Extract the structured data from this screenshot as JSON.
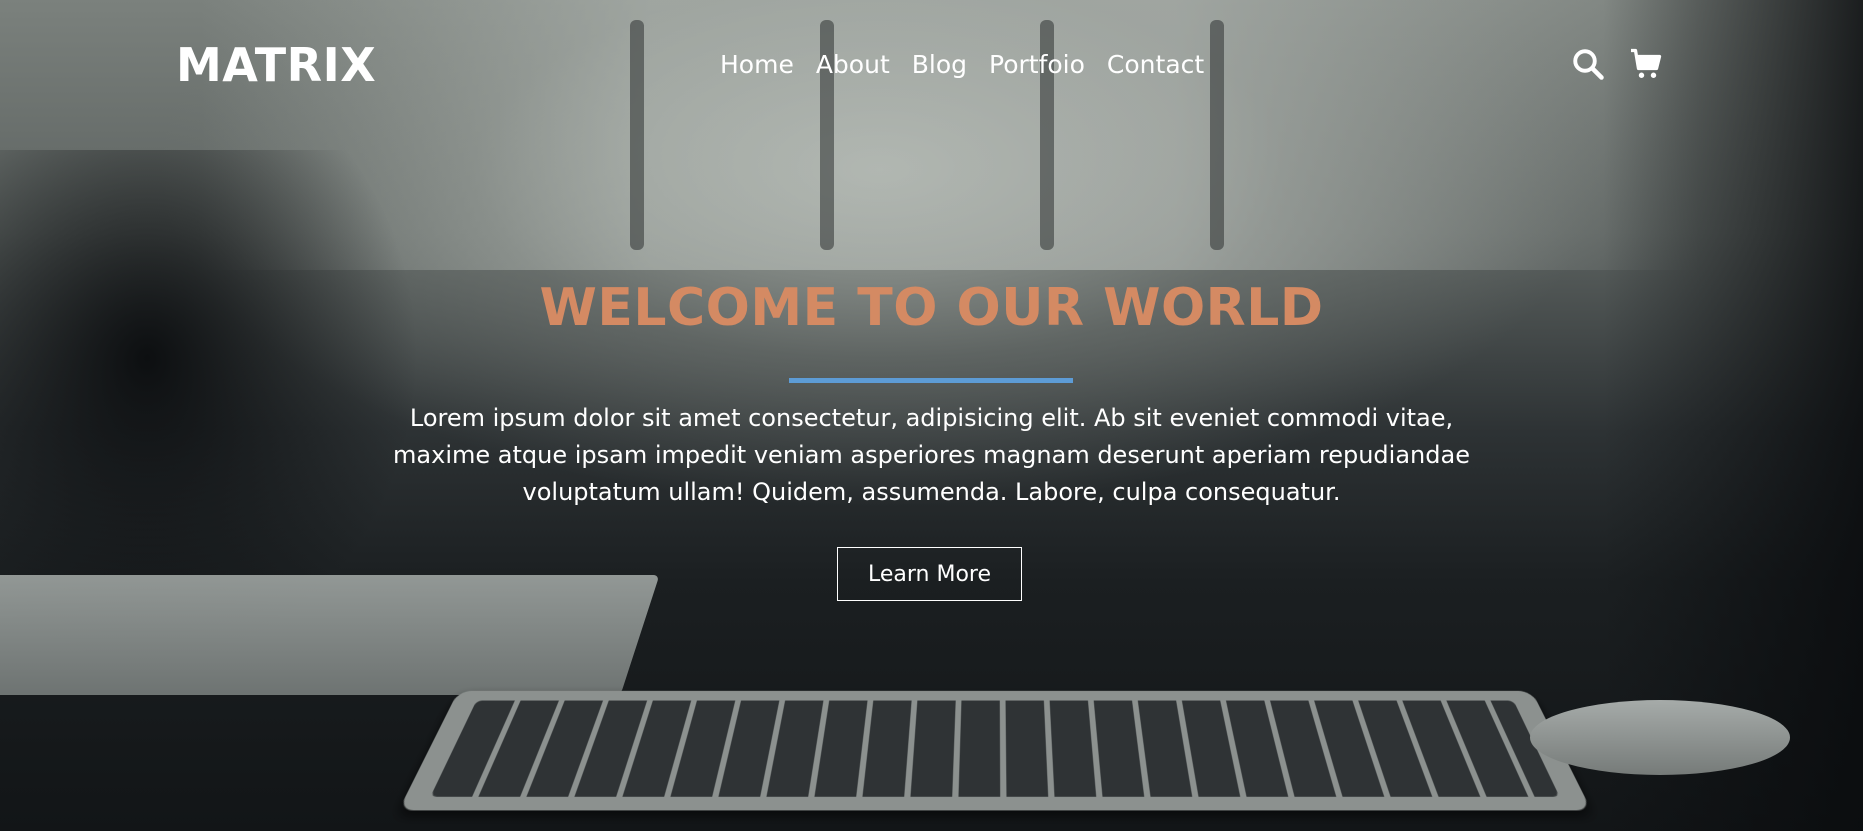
{
  "header": {
    "logo": "MATRIX",
    "nav": [
      "Home",
      "About",
      "Blog",
      "Portfoio",
      "Contact"
    ],
    "icons": [
      "search-icon",
      "cart-icon"
    ]
  },
  "hero": {
    "title": "WELCOME TO OUR WORLD",
    "paragraph": "Lorem ipsum dolor sit amet consectetur, adipisicing elit. Ab sit eveniet commodi vitae, maxime atque ipsam impedit veniam asperiores magnam deserunt aperiam repudiandae voluptatum ullam! Quidem, assumenda. Labore, culpa consequatur.",
    "button_label": "Learn More"
  },
  "colors": {
    "title": "#d48a63",
    "divider": "#5d9cd6",
    "text": "#ffffff"
  }
}
